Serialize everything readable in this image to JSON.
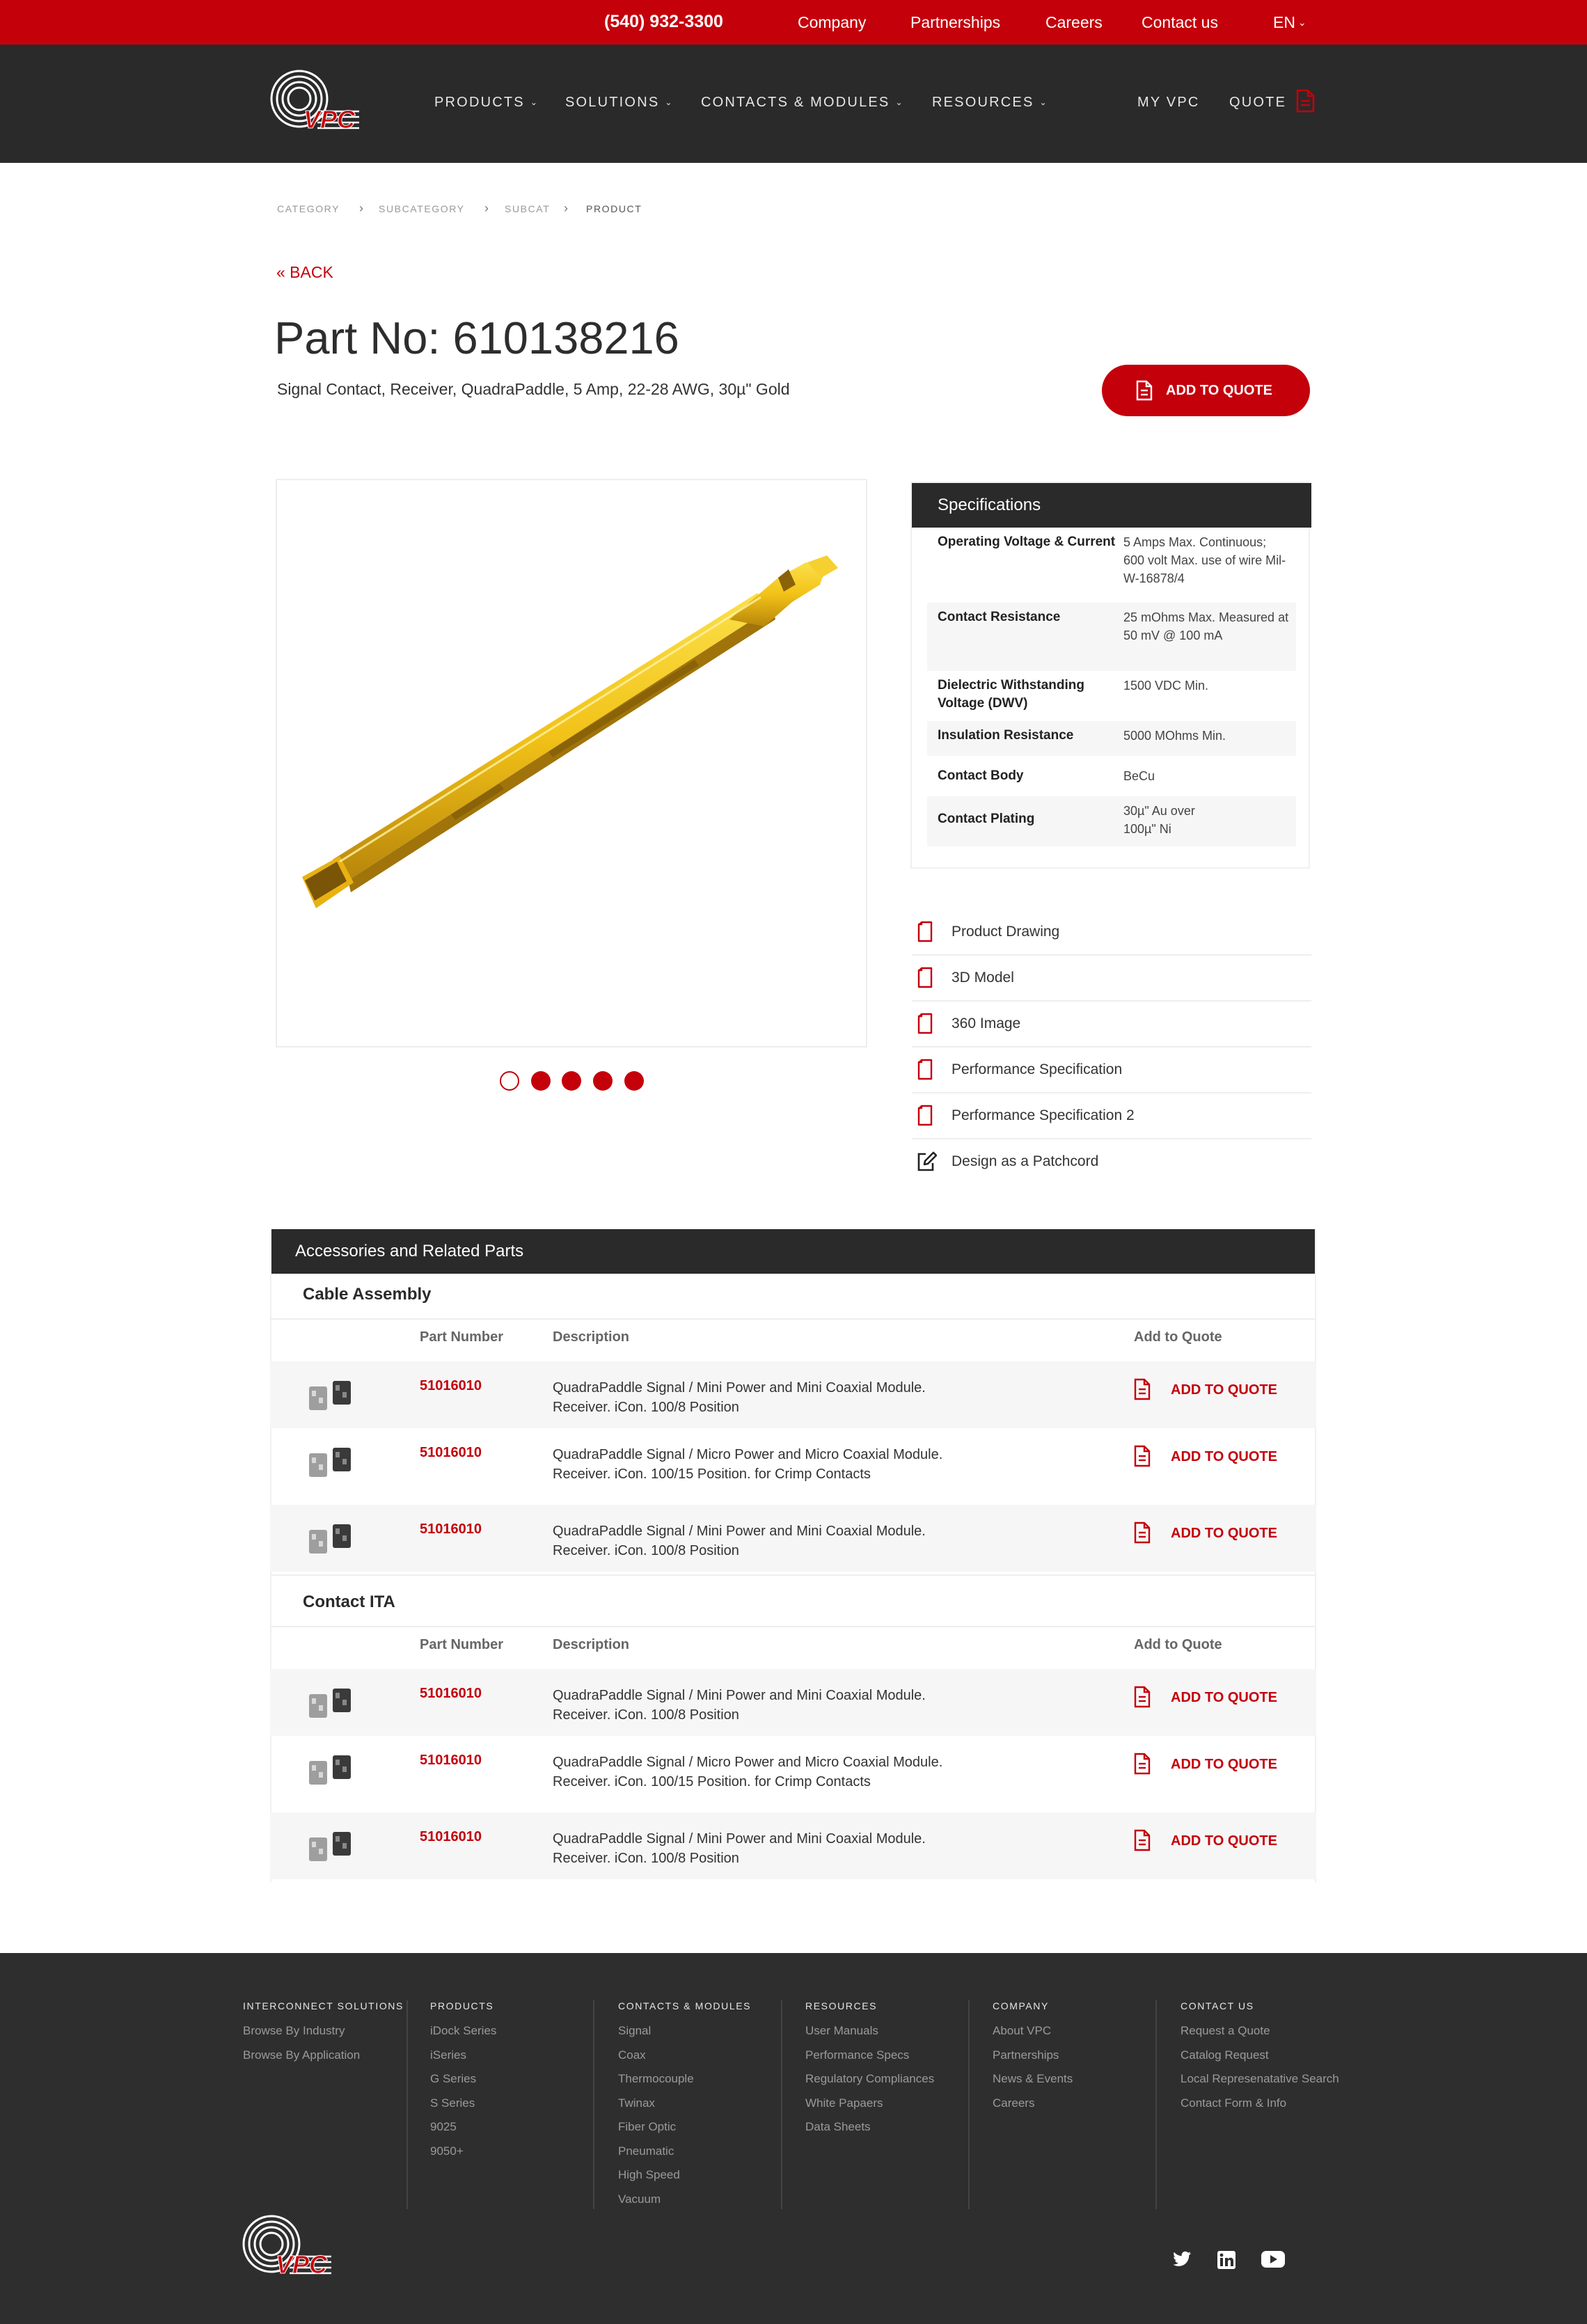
{
  "topbar": {
    "phone": "(540) 932-3300",
    "links": [
      "Company",
      "Partnerships",
      "Careers",
      "Contact us"
    ],
    "language": "EN"
  },
  "nav": {
    "logo_text": "VPC",
    "items": [
      "PRODUCTS",
      "SOLUTIONS",
      "CONTACTS & MODULES",
      "RESOURCES"
    ],
    "my_vpc": "MY VPC",
    "quote": "QUOTE"
  },
  "breadcrumb": [
    "CATEGORY",
    "SUBCATEGORY",
    "SUBCAT",
    "PRODUCT"
  ],
  "back_label": "« BACK",
  "product": {
    "title": "Part No: 610138216",
    "subtitle": "Signal Contact, Receiver, QuadraPaddle, 5 Amp, 22-28 AWG, 30µ\" Gold",
    "add_to_quote": "ADD TO QUOTE"
  },
  "carousel": {
    "slides": 5,
    "active": 0
  },
  "specs": {
    "title": "Specifications",
    "rows": [
      {
        "key": "Operating Voltage & Current",
        "value": "5 Amps Max. Continuous; 600 volt Max. use of wire Mil-W-16878/4"
      },
      {
        "key": "Contact Resistance",
        "value": "25 mOhms Max. Measured at 50 mV @ 100 mA"
      },
      {
        "key": "Dielectric Withstanding Voltage (DWV)",
        "value": "1500 VDC Min."
      },
      {
        "key": "Insulation Resistance",
        "value": "5000 MOhms Min."
      },
      {
        "key": "Contact Body",
        "value": "BeCu"
      },
      {
        "key": "Contact Plating",
        "value": "30µ\" Au over 100µ\" Ni"
      }
    ]
  },
  "downloads": [
    {
      "label": "Product Drawing",
      "icon": "document-icon"
    },
    {
      "label": "3D Model",
      "icon": "document-icon"
    },
    {
      "label": "360 Image",
      "icon": "document-icon"
    },
    {
      "label": "Performance Specification",
      "icon": "document-icon"
    },
    {
      "label": "Performance Specification 2",
      "icon": "document-icon"
    },
    {
      "label": "Design as a Patchcord",
      "icon": "edit-icon"
    }
  ],
  "accessories": {
    "title": "Accessories and Related Parts",
    "columns": {
      "part_number": "Part Number",
      "description": "Description",
      "add_to_quote": "Add to Quote"
    },
    "groups": [
      {
        "name": "Cable Assembly",
        "rows": [
          {
            "pn": "51016010",
            "desc": "QuadraPaddle Signal / Mini Power and Mini Coaxial Module. Receiver. iCon. 100/8 Position",
            "action": "ADD TO QUOTE"
          },
          {
            "pn": "51016010",
            "desc": "QuadraPaddle Signal / Micro Power and Micro Coaxial Module. Receiver. iCon. 100/15 Position. for Crimp Contacts",
            "action": "ADD TO QUOTE"
          },
          {
            "pn": "51016010",
            "desc": "QuadraPaddle Signal / Mini Power and Mini Coaxial Module. Receiver. iCon. 100/8 Position",
            "action": "ADD TO QUOTE"
          }
        ]
      },
      {
        "name": "Contact ITA",
        "rows": [
          {
            "pn": "51016010",
            "desc": "QuadraPaddle Signal / Mini Power and Mini Coaxial Module. Receiver. iCon. 100/8 Position",
            "action": "ADD TO QUOTE"
          },
          {
            "pn": "51016010",
            "desc": "QuadraPaddle Signal / Micro Power and Micro Coaxial Module. Receiver. iCon. 100/15 Position. for Crimp Contacts",
            "action": "ADD TO QUOTE"
          },
          {
            "pn": "51016010",
            "desc": "QuadraPaddle Signal / Mini Power and Mini Coaxial Module. Receiver. iCon. 100/8 Position",
            "action": "ADD TO QUOTE"
          }
        ]
      }
    ]
  },
  "footer": {
    "columns": [
      {
        "heading": "INTERCONNECT SOLUTIONS",
        "links": [
          "Browse By Industry",
          "Browse By Application"
        ]
      },
      {
        "heading": "PRODUCTS",
        "links": [
          "iDock Series",
          "iSeries",
          "G Series",
          "S Series",
          "9025",
          "9050+"
        ]
      },
      {
        "heading": "CONTACTS & MODULES",
        "links": [
          "Signal",
          "Coax",
          "Thermocouple",
          "Twinax",
          "Fiber Optic",
          "Pneumatic",
          "High Speed",
          "Vacuum"
        ]
      },
      {
        "heading": "RESOURCES",
        "links": [
          "User Manuals",
          "Performance Specs",
          "Regulatory Compliances",
          "White Papaers",
          "Data Sheets"
        ]
      },
      {
        "heading": "COMPANY",
        "links": [
          "About VPC",
          "Partnerships",
          "News & Events",
          "Careers"
        ]
      },
      {
        "heading": "CONTACT US",
        "links": [
          "Request a Quote",
          "Catalog Request",
          "Local Represenatative Search",
          "Contact Form & Info"
        ]
      }
    ],
    "social": [
      "twitter-icon",
      "linkedin-icon",
      "youtube-icon"
    ]
  },
  "colors": {
    "brand_red": "#c4000b",
    "dark": "#2a2a2a",
    "gold": "#f2c218"
  }
}
